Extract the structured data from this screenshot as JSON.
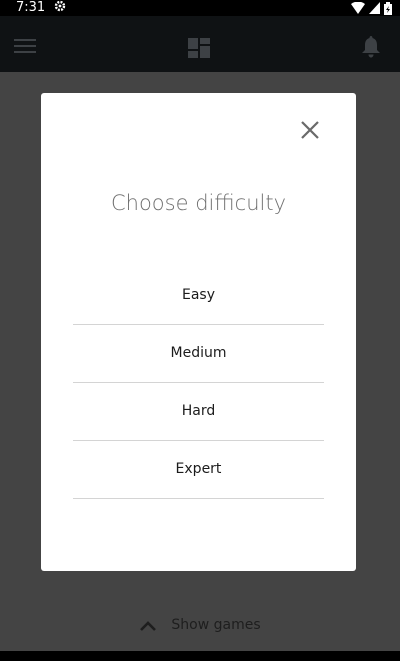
{
  "status_bar": {
    "time": "7:31",
    "icons": [
      "gear-icon",
      "wifi-icon",
      "signal-icon",
      "battery-icon"
    ]
  },
  "app_bar": {
    "icons": [
      "menu-icon",
      "dashboard-icon",
      "bell-icon"
    ]
  },
  "dialog": {
    "title": "Choose difficulty",
    "close_icon": "close-icon",
    "options": [
      {
        "label": "Easy"
      },
      {
        "label": "Medium"
      },
      {
        "label": "Hard"
      },
      {
        "label": "Expert"
      }
    ]
  },
  "footer": {
    "show_games_label": "Show games",
    "icon": "chevron-up-icon"
  },
  "colors": {
    "overlay": "#3a3a3a",
    "appbar": "#0f1214",
    "dialog_bg": "#ffffff",
    "title_text": "#707070",
    "divider": "#d4d4d4"
  }
}
